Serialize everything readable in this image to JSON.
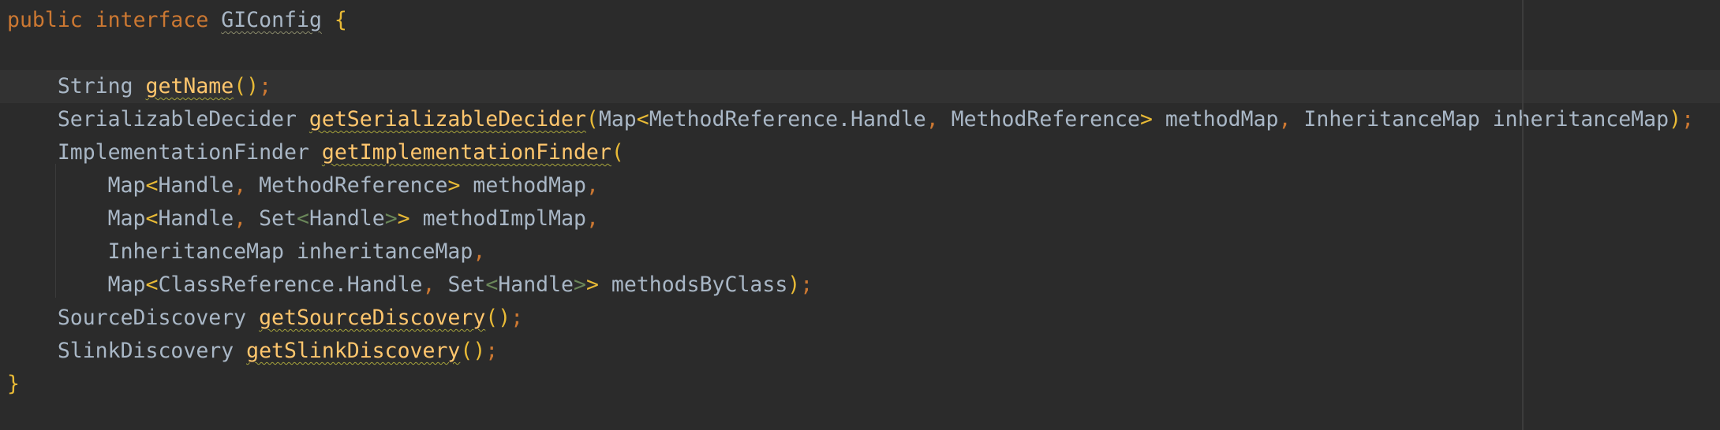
{
  "editor": {
    "language": "java",
    "colors": {
      "background": "#2b2b2b",
      "current_line": "#323232",
      "keyword": "#cc7832",
      "method": "#ffc66d",
      "identifier": "#a9b7c6",
      "bracket": "#e8ba36",
      "nested_generic": "#6a8759"
    },
    "lines": [
      {
        "tokens": [
          {
            "t": "public",
            "c": "kw"
          },
          {
            "t": " ",
            "c": "tp"
          },
          {
            "t": "interface",
            "c": "kw"
          },
          {
            "t": " ",
            "c": "tp"
          },
          {
            "t": "GIConfig",
            "c": "tp",
            "sq": "sq-grey"
          },
          {
            "t": " ",
            "c": "tp"
          },
          {
            "t": "{",
            "c": "br"
          }
        ]
      },
      {
        "tokens": []
      },
      {
        "current": true,
        "tokens": [
          {
            "t": "    String ",
            "c": "tp"
          },
          {
            "t": "getName",
            "c": "fn",
            "sq": "sq"
          },
          {
            "t": "()",
            "c": "br"
          },
          {
            "t": ";",
            "c": "pn"
          }
        ]
      },
      {
        "tokens": [
          {
            "t": "    SerializableDecider ",
            "c": "tp"
          },
          {
            "t": "getSerializableDecider",
            "c": "fn",
            "sq": "sq"
          },
          {
            "t": "(",
            "c": "br"
          },
          {
            "t": "Map",
            "c": "tp"
          },
          {
            "t": "<",
            "c": "ang"
          },
          {
            "t": "MethodReference.Handle",
            "c": "tp"
          },
          {
            "t": ", ",
            "c": "pn"
          },
          {
            "t": "MethodReference",
            "c": "tp"
          },
          {
            "t": ">",
            "c": "ang"
          },
          {
            "t": " methodMap",
            "c": "tp"
          },
          {
            "t": ", ",
            "c": "pn"
          },
          {
            "t": "InheritanceMap inheritanceMap",
            "c": "tp"
          },
          {
            "t": ")",
            "c": "br"
          },
          {
            "t": ";",
            "c": "pn"
          }
        ]
      },
      {
        "tokens": [
          {
            "t": "    ImplementationFinder ",
            "c": "tp"
          },
          {
            "t": "getImplementationFinder",
            "c": "fn",
            "sq": "sq"
          },
          {
            "t": "(",
            "c": "br"
          }
        ]
      },
      {
        "tokens": [
          {
            "t": "        Map",
            "c": "tp"
          },
          {
            "t": "<",
            "c": "ang"
          },
          {
            "t": "Handle",
            "c": "tp"
          },
          {
            "t": ", ",
            "c": "pn"
          },
          {
            "t": "MethodReference",
            "c": "tp"
          },
          {
            "t": ">",
            "c": "ang"
          },
          {
            "t": " methodMap",
            "c": "tp"
          },
          {
            "t": ",",
            "c": "pn"
          }
        ]
      },
      {
        "tokens": [
          {
            "t": "        Map",
            "c": "tp"
          },
          {
            "t": "<",
            "c": "ang"
          },
          {
            "t": "Handle",
            "c": "tp"
          },
          {
            "t": ", ",
            "c": "pn"
          },
          {
            "t": "Set",
            "c": "tp"
          },
          {
            "t": "<",
            "c": "ang2"
          },
          {
            "t": "Handle",
            "c": "tp"
          },
          {
            "t": ">",
            "c": "ang2"
          },
          {
            "t": ">",
            "c": "ang"
          },
          {
            "t": " methodImplMap",
            "c": "tp"
          },
          {
            "t": ",",
            "c": "pn"
          }
        ]
      },
      {
        "tokens": [
          {
            "t": "        InheritanceMap inheritanceMap",
            "c": "tp"
          },
          {
            "t": ",",
            "c": "pn"
          }
        ]
      },
      {
        "tokens": [
          {
            "t": "        Map",
            "c": "tp"
          },
          {
            "t": "<",
            "c": "ang"
          },
          {
            "t": "ClassReference.Handle",
            "c": "tp"
          },
          {
            "t": ", ",
            "c": "pn"
          },
          {
            "t": "Set",
            "c": "tp"
          },
          {
            "t": "<",
            "c": "ang2"
          },
          {
            "t": "Handle",
            "c": "tp"
          },
          {
            "t": ">",
            "c": "ang2"
          },
          {
            "t": ">",
            "c": "ang"
          },
          {
            "t": " methodsByClass",
            "c": "tp"
          },
          {
            "t": ")",
            "c": "br"
          },
          {
            "t": ";",
            "c": "pn"
          }
        ]
      },
      {
        "tokens": [
          {
            "t": "    SourceDiscovery ",
            "c": "tp"
          },
          {
            "t": "getSourceDiscovery",
            "c": "fn",
            "sq": "sq"
          },
          {
            "t": "()",
            "c": "br"
          },
          {
            "t": ";",
            "c": "pn"
          }
        ]
      },
      {
        "tokens": [
          {
            "t": "    SlinkDiscovery ",
            "c": "tp"
          },
          {
            "t": "getSlinkDiscovery",
            "c": "fn",
            "sq": "sq"
          },
          {
            "t": "()",
            "c": "br"
          },
          {
            "t": ";",
            "c": "pn"
          }
        ]
      },
      {
        "tokens": [
          {
            "t": "}",
            "c": "br"
          }
        ]
      }
    ]
  }
}
